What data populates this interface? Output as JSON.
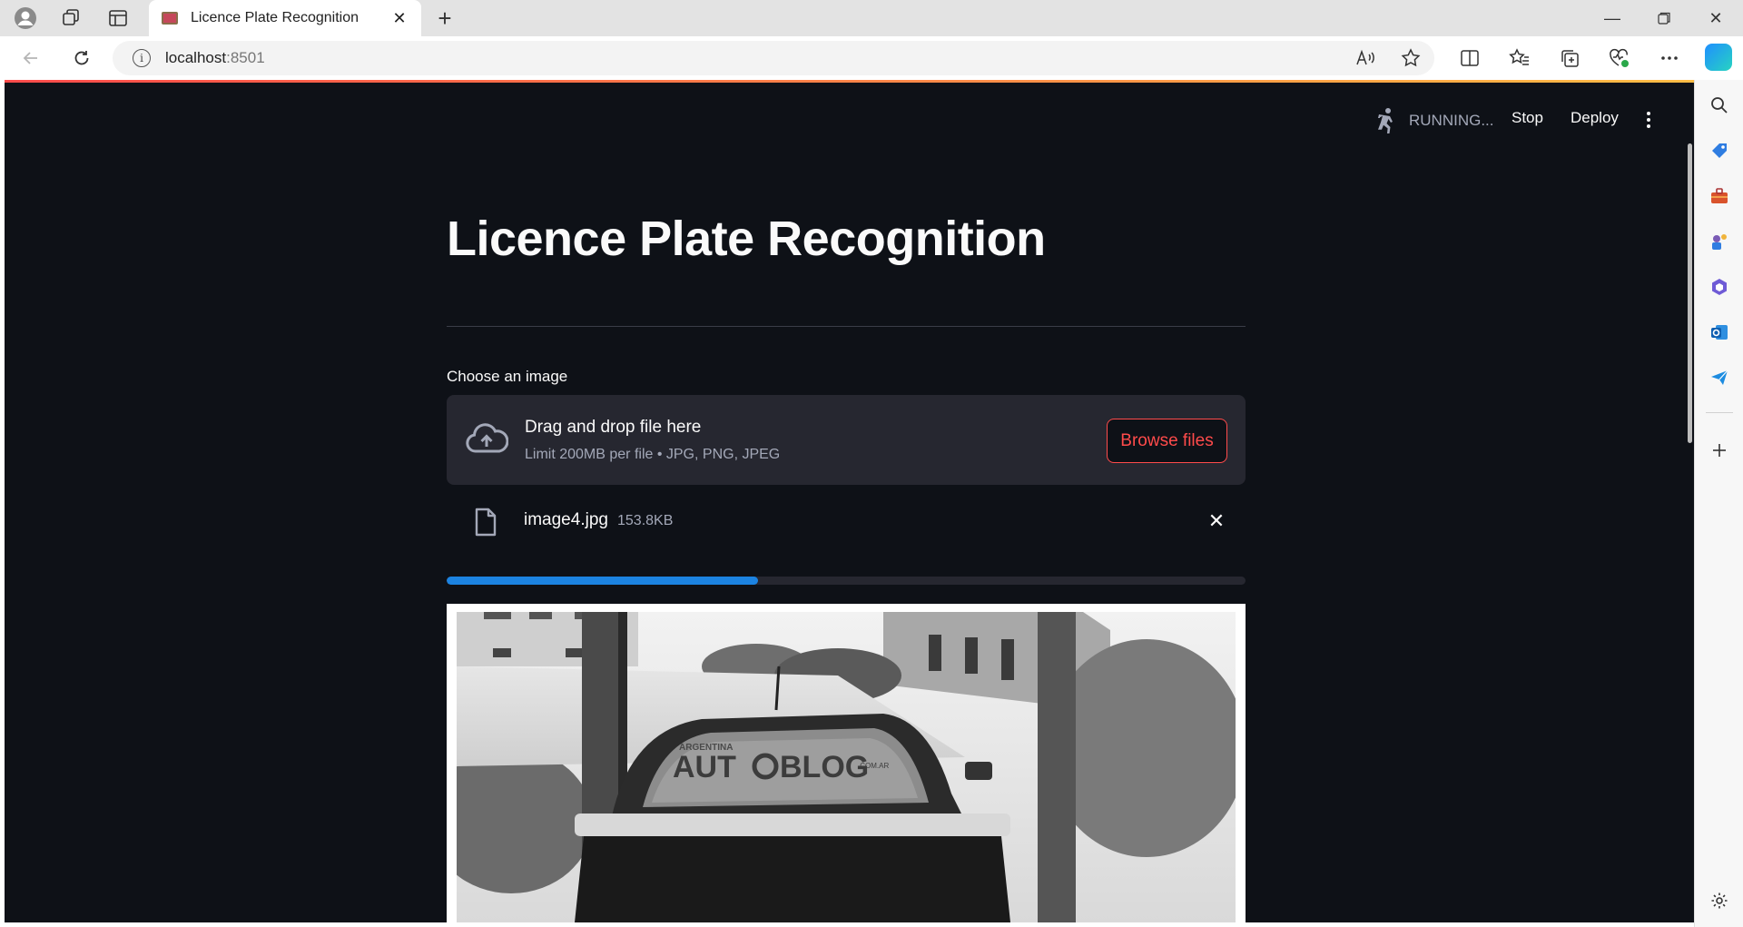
{
  "browser": {
    "tab_title": "Licence Plate Recognition",
    "url_host": "localhost",
    "url_port": ":8501"
  },
  "app_header": {
    "status": "RUNNING...",
    "stop_label": "Stop",
    "deploy_label": "Deploy"
  },
  "page": {
    "title": "Licence Plate Recognition",
    "uploader_label": "Choose an image",
    "dropzone_title": "Drag and drop file here",
    "dropzone_limit": "Limit 200MB per file • JPG, PNG, JPEG",
    "browse_label": "Browse files"
  },
  "file": {
    "name": "image4.jpg",
    "size": "153.8KB"
  },
  "progress": {
    "fraction": 0.39
  },
  "image": {
    "watermark_country": "ARGENTINA",
    "watermark_brand_a": "AUT",
    "watermark_brand_b": "BLOG",
    "watermark_domain": ".COM.AR"
  },
  "colors": {
    "app_bg": "#0e1117",
    "primary": "#ff4b4b",
    "progress": "#1c83e1",
    "surface": "#262730"
  }
}
